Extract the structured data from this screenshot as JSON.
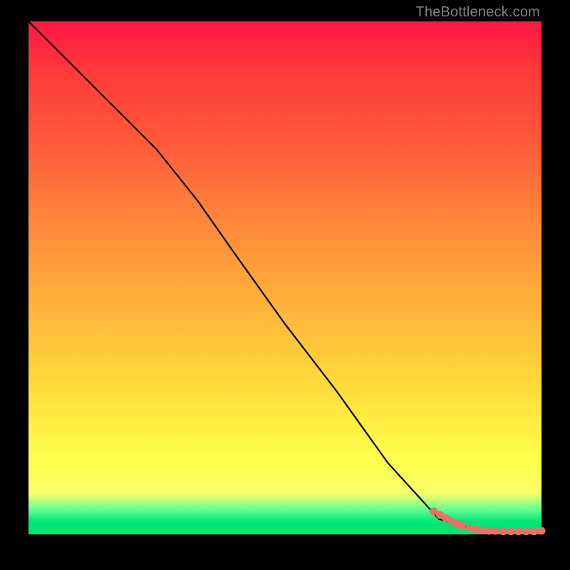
{
  "watermark": "TheBottleneck.com",
  "colors": {
    "gradient_top": "#ff1744",
    "gradient_mid": "#ffff4a",
    "gradient_green": "#00e676",
    "line": "#000000",
    "points": "#e57368",
    "frame": "#000000"
  },
  "chart_data": {
    "type": "line",
    "title": "",
    "xlabel": "",
    "ylabel": "",
    "xlim": [
      0,
      100
    ],
    "ylim": [
      0,
      100
    ],
    "grid": false,
    "legend": false,
    "series": [
      {
        "name": "curve",
        "kind": "line",
        "x": [
          0,
          5,
          10,
          15,
          20,
          25,
          29,
          33,
          40,
          50,
          60,
          70,
          80,
          85,
          90,
          93,
          95,
          97,
          100
        ],
        "y": [
          100,
          95,
          90,
          85,
          80,
          75,
          70,
          65,
          55,
          41,
          28,
          14,
          3,
          1.5,
          0.8,
          0.6,
          0.5,
          0.5,
          0.5
        ]
      },
      {
        "name": "points",
        "kind": "scatter",
        "x": [
          79.0,
          80.2,
          81.3,
          82.4,
          83.5,
          84.5,
          86.0,
          87.2,
          88.5,
          89.8,
          91.0,
          92.5,
          94.0,
          95.5,
          97.0,
          98.5,
          100.0
        ],
        "y": [
          4.5,
          3.8,
          3.2,
          2.6,
          2.1,
          1.7,
          1.2,
          0.9,
          0.8,
          0.7,
          0.7,
          0.6,
          0.6,
          0.6,
          0.6,
          0.6,
          0.7
        ]
      }
    ]
  }
}
